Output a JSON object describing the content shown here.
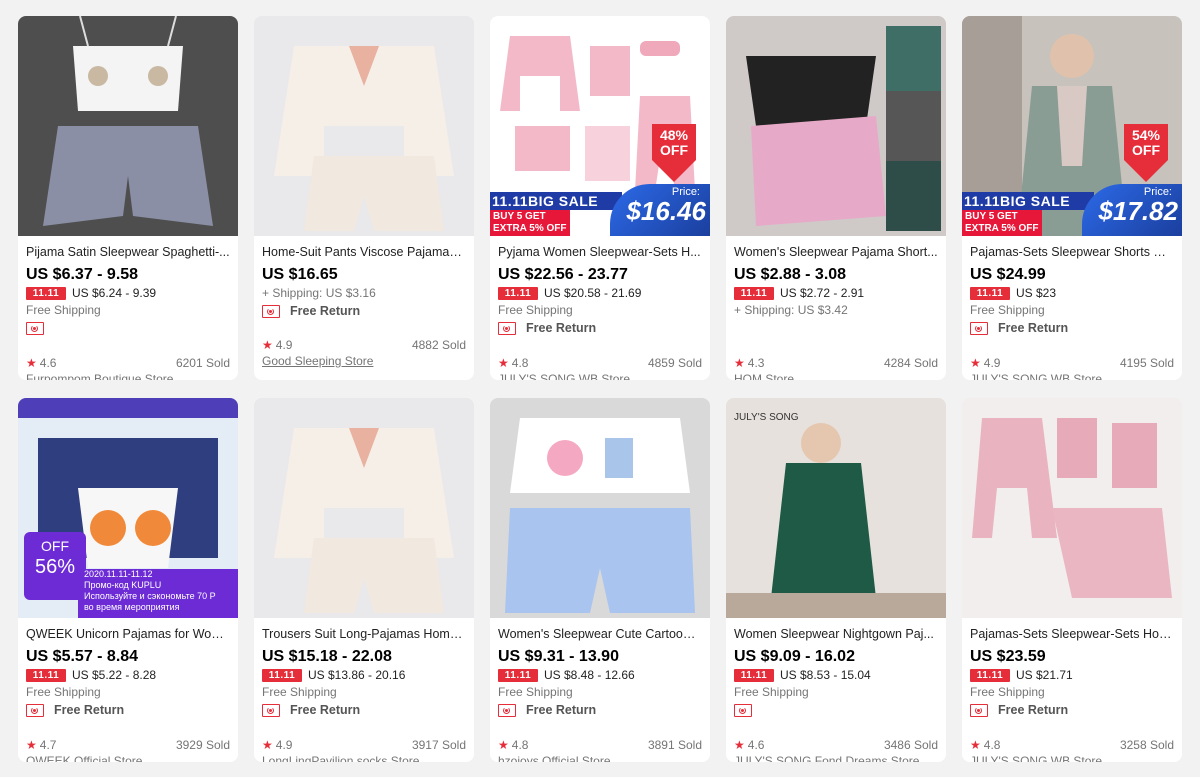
{
  "colors": {
    "accent": "#e62e3b",
    "banner_blue": "#1f3ca6",
    "purple": "#6d2bd6"
  },
  "tag_label": "11.11",
  "return_label": "Free Return",
  "products": [
    {
      "title": "Pijama Satin Sleepwear Spaghetti-...",
      "price": "US $6.37 - 9.58",
      "promo_price": "US $6.24 - 9.39",
      "shipping": "Free Shipping",
      "free_return": false,
      "rating": "4.6",
      "sold": "6201 Sold",
      "store": "Furpompom Boutique Store",
      "icon_only": true
    },
    {
      "title": "Home-Suit Pants Viscose Pajamas ...",
      "price": "US $16.65",
      "promo_price": "",
      "shipping": "+ Shipping: US $3.16",
      "free_return": true,
      "rating": "4.9",
      "sold": "4882 Sold",
      "store": "Good Sleeping Store"
    },
    {
      "title": "Pyjama Women Sleepwear-Sets H...",
      "price": "US $22.56 - 23.77",
      "promo_price": "US $20.58 - 21.69",
      "shipping": "Free Shipping",
      "free_return": true,
      "rating": "4.8",
      "sold": "4859 Sold",
      "store": "JULY'S SONG WB Store",
      "overlay": {
        "discount": "48%\nOFF",
        "banner_title": "11.11BIG SALE",
        "banner_line1": "BUY 5 GET",
        "banner_line2": "EXTRA 5% OFF",
        "price_label": "Price:",
        "price_value": "$16.46"
      }
    },
    {
      "title": "Women's Sleepwear Pajama Short...",
      "price": "US $2.88 - 3.08",
      "promo_price": "US $2.72 - 2.91",
      "shipping": "+ Shipping: US $3.42",
      "free_return": false,
      "rating": "4.3",
      "sold": "4284 Sold",
      "store": "HQM Store"
    },
    {
      "title": "Pajamas-Sets Sleepwear Shorts Vis...",
      "price": "US $24.99",
      "promo_price": "US $23",
      "shipping": "Free Shipping",
      "free_return": true,
      "rating": "4.9",
      "sold": "4195 Sold",
      "store": "JULY'S SONG WB Store",
      "overlay": {
        "discount": "54%\nOFF",
        "banner_title": "11.11BIG SALE",
        "banner_line1": "BUY 5 GET",
        "banner_line2": "EXTRA 5% OFF",
        "price_label": "Price:",
        "price_value": "$17.82"
      }
    },
    {
      "title": "QWEEK Unicorn Pajamas for Wom...",
      "price": "US $5.57 - 8.84",
      "promo_price": "US $5.22 - 8.28",
      "shipping": "Free Shipping",
      "free_return": true,
      "rating": "4.7",
      "sold": "3929 Sold",
      "store": "QWEEK Official Store",
      "qweek": {
        "off": "OFF",
        "pct": "56%",
        "date": "2020.11.11-11.12",
        "promo": "Промо-код  KUPLU",
        "line1": "Используйте и сэкономьте 70 Р",
        "line2": "во время мероприятия"
      }
    },
    {
      "title": "Trousers Suit Long-Pajamas Home...",
      "price": "US $15.18 - 22.08",
      "promo_price": "US $13.86 - 20.16",
      "shipping": "Free Shipping",
      "free_return": true,
      "rating": "4.9",
      "sold": "3917 Sold",
      "store": "LongLingPavilion socks Store"
    },
    {
      "title": "Women's Sleepwear Cute Cartoon ...",
      "price": "US $9.31 - 13.90",
      "promo_price": "US $8.48 - 12.66",
      "shipping": "Free Shipping",
      "free_return": true,
      "rating": "4.8",
      "sold": "3891 Sold",
      "store": "hzoioys Official Store"
    },
    {
      "title": "Women Sleepwear Nightgown Paj...",
      "price": "US $9.09 - 16.02",
      "promo_price": "US $8.53 - 15.04",
      "shipping": "Free Shipping",
      "free_return": false,
      "rating": "4.6",
      "sold": "3486 Sold",
      "store": "JULY'S SONG Fond Dreams Store",
      "icon_only": true,
      "brand": "JULY'S SONG"
    },
    {
      "title": "Pajamas-Sets Sleepwear-Sets Hom...",
      "price": "US $23.59",
      "promo_price": "US $21.71",
      "shipping": "Free Shipping",
      "free_return": true,
      "rating": "4.8",
      "sold": "3258 Sold",
      "store": "JULY'S SONG WB Store"
    }
  ]
}
